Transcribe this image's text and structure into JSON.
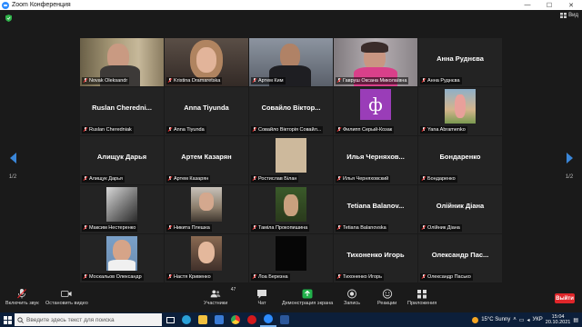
{
  "window": {
    "title": "Zoom Конференция",
    "minimize": "—",
    "maximize": "☐",
    "close": "✕"
  },
  "view_button": "Вид",
  "pager": {
    "left": "1/2",
    "right": "1/2"
  },
  "tiles": [
    {
      "name": "Novak Oleksandr",
      "video": "man-glasses",
      "active": true,
      "muted": true
    },
    {
      "name": "Kristina Dramaretska",
      "video": "woman-blonde",
      "muted": true
    },
    {
      "name": "Артем Ким",
      "video": "man-dark",
      "muted": true
    },
    {
      "name": "Гавруш Оксана Миколаївна",
      "video": "woman-pink",
      "muted": true
    },
    {
      "name": "Анна Руднєва",
      "bigname": "Анна Руднєва",
      "muted": true
    },
    {
      "name": "Ruslan Cherednіak",
      "bigname": "Ruslan Cheredni...",
      "muted": true
    },
    {
      "name": "Anna Tiyunda",
      "bigname": "Anna Tiyunda",
      "muted": true
    },
    {
      "name": "Совайло Вікторія Совайл...",
      "bigname": "Совайло Віктор...",
      "muted": true
    },
    {
      "name": "Филипп Серый-Козак",
      "video": "purple-f",
      "muted": true
    },
    {
      "name": "Yana Abramenko",
      "video": "woman-outdoor",
      "muted": true
    },
    {
      "name": "Алищук Дарья",
      "bigname": "Алищук Дарья",
      "muted": true
    },
    {
      "name": "Артем Казарян",
      "bigname": "Артем Казарян",
      "muted": true
    },
    {
      "name": "Ростислав Білан",
      "video": "beige",
      "muted": true
    },
    {
      "name": "Илья Черняховский",
      "bigname": "Илья Черняхов...",
      "muted": true
    },
    {
      "name": "Бондаренко",
      "bigname": "Бондаренко",
      "muted": true
    },
    {
      "name": "Максим Нестеренко",
      "video": "bw-scene",
      "muted": true
    },
    {
      "name": "Никита Плешка",
      "video": "car-photo",
      "muted": true
    },
    {
      "name": "Таміла Прокопишина",
      "video": "woman-forest",
      "muted": true
    },
    {
      "name": "Tetiana Balanovska",
      "bigname": "Tetiana Balanov...",
      "muted": true
    },
    {
      "name": "Олійник Діана",
      "bigname": "Олійник Діана",
      "muted": true
    },
    {
      "name": "Москальов Олександр",
      "video": "man-white",
      "muted": true
    },
    {
      "name": "Настя Кривенко",
      "video": "woman-portrait",
      "muted": true
    },
    {
      "name": "Лоа Березна",
      "video": "black",
      "muted": true
    },
    {
      "name": "Тихоненко Игорь",
      "bigname": "Тихоненко Игорь",
      "muted": true
    },
    {
      "name": "Олександр Пасько",
      "bigname": "Олександр Пас...",
      "muted": true
    }
  ],
  "toolbar": {
    "unmute": "Включить звук",
    "start_video": "Остановить видео",
    "participants": "Участники",
    "participants_count": "47",
    "chat": "Чат",
    "share": "Демонстрация экрана",
    "record": "Запись",
    "reactions": "Реакции",
    "apps": "Приложения",
    "leave": "Выйти"
  },
  "taskbar": {
    "search_placeholder": "Введите здесь текст для поиска",
    "weather": "15°C  Sunny",
    "lang": "УКР",
    "time": "15:04",
    "date": "20.10.2021"
  },
  "colors": {
    "accent": "#2d8cff",
    "share_green": "#21b14b",
    "leave_red": "#e0262a",
    "active_border": "#b8e34a"
  }
}
